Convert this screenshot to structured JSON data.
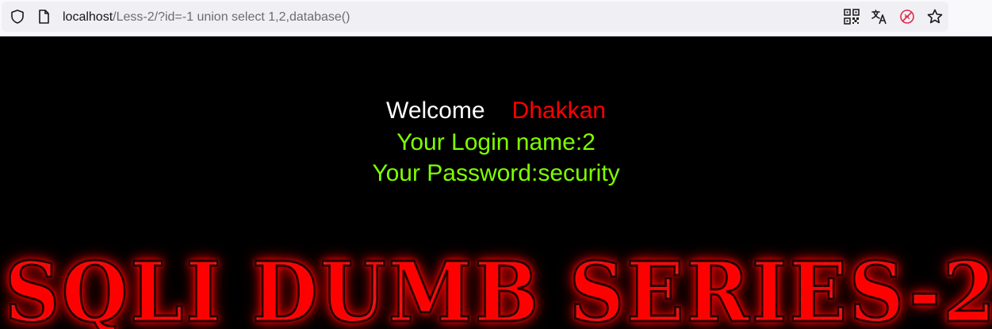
{
  "browser": {
    "url_host": "localhost",
    "url_path": "/Less-2/?id=-1 union select 1,2,database()"
  },
  "page": {
    "welcome": "Welcome",
    "name": "Dhakkan",
    "login_line": "Your Login name:2",
    "password_line": "Your Password:security",
    "banner": "SQLI DUMB SERIES-2"
  },
  "colors": {
    "background": "#000000",
    "welcome": "#ffffff",
    "name": "#ff0000",
    "result": "#7fff00"
  },
  "icons": [
    "shield-icon",
    "page-icon",
    "qr-code-icon",
    "translate-icon",
    "blocked-icon",
    "bookmark-star-icon"
  ]
}
